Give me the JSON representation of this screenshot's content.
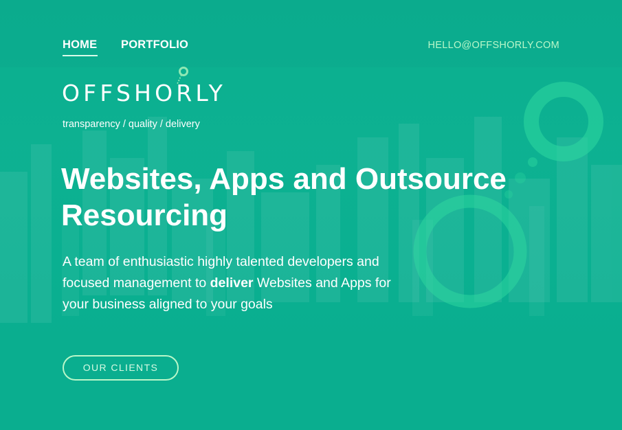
{
  "nav": {
    "home": "HOME",
    "portfolio": "PORTFOLIO",
    "email": "HELLO@OFFSHORLY.COM"
  },
  "brand": {
    "logo_text": "OFFSHORLY",
    "tagline": "transparency / quality / delivery"
  },
  "hero": {
    "headline": "Websites, Apps and Outsource Resourcing",
    "description_before": "A team of enthusiastic highly talented developers and focused management to ",
    "description_bold": "deliver",
    "description_after": " Websites and Apps for your business aligned to your goals",
    "cta_label": "OUR CLIENTS"
  },
  "colors": {
    "background": "#0aae8f",
    "accent_green": "#b9f7c9",
    "ring_green": "#2fd9a0"
  }
}
